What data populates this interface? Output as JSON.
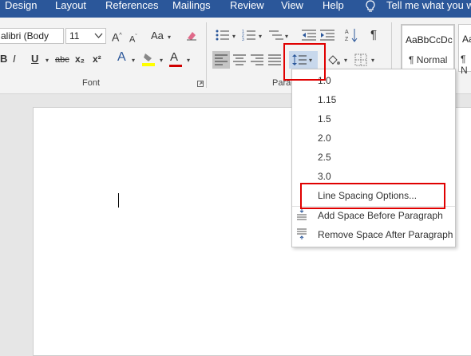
{
  "tabs": [
    "Design",
    "Layout",
    "References",
    "Mailings",
    "Review",
    "View",
    "Help"
  ],
  "tell_me": "Tell me what you wa",
  "font": {
    "name": "alibri (Body",
    "size": "11",
    "group_label": "Font",
    "bold": "B",
    "underline": "U",
    "strike": "abc",
    "subscript": "x₂",
    "superscript": "x²",
    "case": "Aa",
    "grow": "A",
    "shrink": "A",
    "text_effects": "A",
    "font_color": "A",
    "highlight_color": "#ffff00",
    "font_color_bar": "#d00000"
  },
  "paragraph": {
    "group_label": "Paragra"
  },
  "styles": [
    {
      "preview": "AaBbCcDc",
      "name": "¶ Normal"
    },
    {
      "preview": "Aa",
      "name": "¶ N"
    }
  ],
  "line_spacing_menu": {
    "options": [
      "1.0",
      "1.15",
      "1.5",
      "2.0",
      "2.5",
      "3.0"
    ],
    "line_spacing_options": "Line Spacing Options...",
    "add_space_before": "Add Space Before Paragraph",
    "remove_space_after": "Remove Space After Paragraph"
  },
  "highlight_color": "#e00000",
  "accent_color": "#2b579a"
}
